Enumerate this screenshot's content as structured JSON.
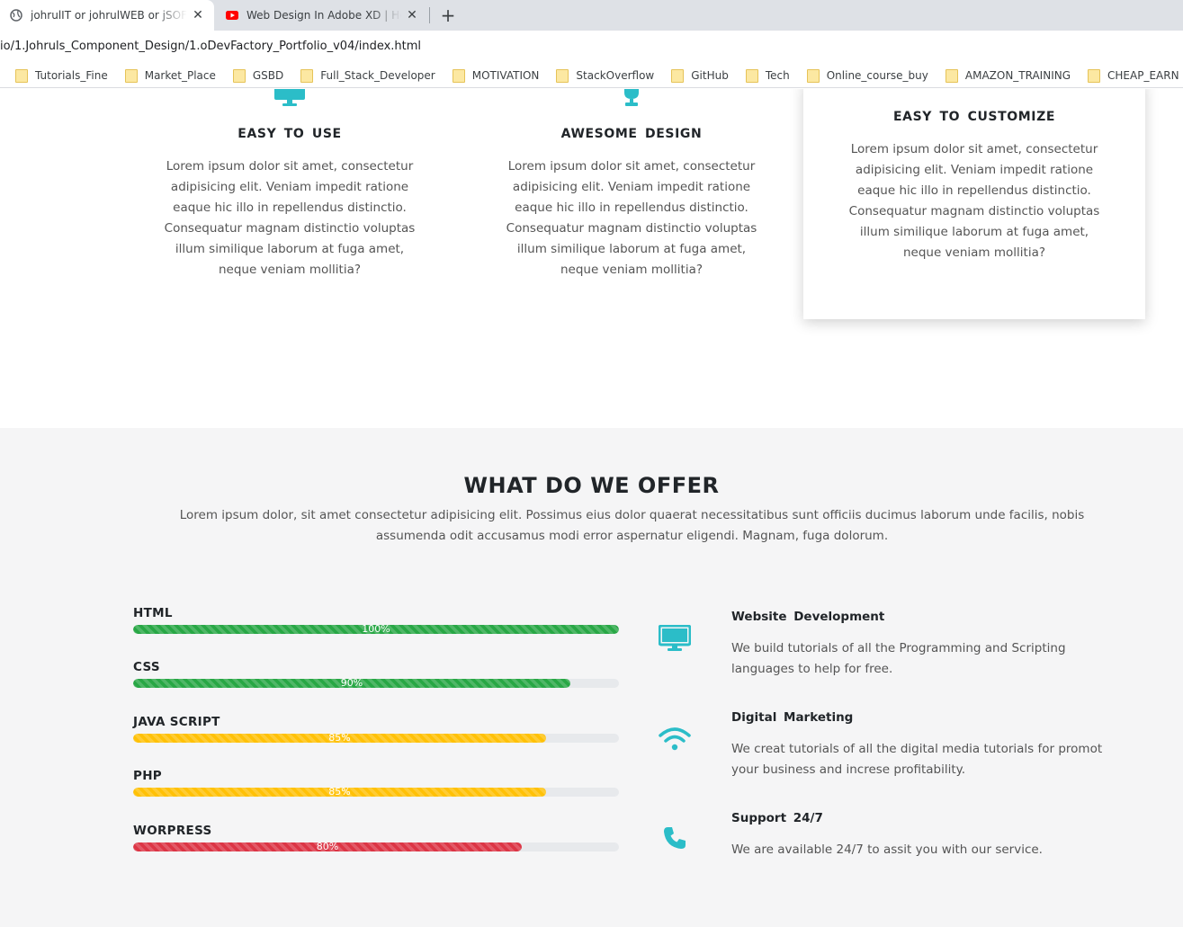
{
  "browser": {
    "tabs": [
      {
        "title": "johrulIT or johrulWEB or jSOFT or ...",
        "active": true
      },
      {
        "title": "Web Design In Adobe XD | How To Design",
        "active": false
      }
    ],
    "url": "io/1.Johruls_Component_Design/1.oDevFactory_Portfolio_v04/index.html",
    "bookmarks": [
      "Tutorials_Fine",
      "Market_Place",
      "GSBD",
      "Full_Stack_Developer",
      "MOTIVATION",
      "StackOverflow",
      "GitHub",
      "Tech",
      "Online_course_buy",
      "AMAZON_TRAINING",
      "CHEAP_EARN"
    ]
  },
  "features": [
    {
      "icon": "monitor-icon",
      "title": "EASY  TO  USE",
      "text": "Lorem ipsum dolor sit amet, consectetur adipisicing elit. Veniam impedit ratione eaque hic illo in repellendus distinctio. Consequatur magnam distinctio voluptas illum similique laborum at fuga amet, neque veniam mollitia?"
    },
    {
      "icon": "trophy-icon",
      "title": "AWESOME  DESIGN",
      "text": "Lorem ipsum dolor sit amet, consectetur adipisicing elit. Veniam impedit ratione eaque hic illo in repellendus distinctio. Consequatur magnam distinctio voluptas illum similique laborum at fuga amet, neque veniam mollitia?"
    },
    {
      "icon": "",
      "title": "EASY  TO  CUSTOMIZE",
      "text": "Lorem ipsum dolor sit amet, consectetur adipisicing elit. Veniam impedit ratione eaque hic illo in repellendus distinctio. Consequatur magnam distinctio voluptas illum similique laborum at fuga amet, neque veniam mollitia?"
    }
  ],
  "offer": {
    "heading": "WHAT DO WE OFFER",
    "lead": "Lorem ipsum dolor, sit amet consectetur adipisicing elit. Possimus eius dolor quaerat necessitatibus sunt officiis ducimus laborum unde facilis, nobis assumenda odit accusamus modi error aspernatur eligendi. Magnam, fuga dolorum.",
    "skills": [
      {
        "name": "HTML",
        "percent": 100,
        "label": "100%",
        "color": "#28a745"
      },
      {
        "name": "CSS",
        "percent": 90,
        "label": "90%",
        "color": "#28a745"
      },
      {
        "name": "JAVA SCRIPT",
        "percent": 85,
        "label": "85%",
        "color": "#ffc107"
      },
      {
        "name": "PHP",
        "percent": 85,
        "label": "85%",
        "color": "#ffc107"
      },
      {
        "name": "WORPRESS",
        "percent": 80,
        "label": "80%",
        "color": "#dc3545"
      }
    ],
    "services": [
      {
        "icon": "desktop-icon",
        "title": "Website  Development",
        "text": "We build tutorials of all the Programming and Scripting languages to help for free."
      },
      {
        "icon": "wifi-icon",
        "title": "Digital  Marketing",
        "text": "We creat tutorials of all the digital media tutorials for promot your business and increse profitability."
      },
      {
        "icon": "phone-icon",
        "title": "Support  24/7",
        "text": "We are available 24/7 to assit you with our service."
      }
    ]
  },
  "colors": {
    "accent": "#2bbdc8",
    "section_bg": "#f5f5f6"
  }
}
